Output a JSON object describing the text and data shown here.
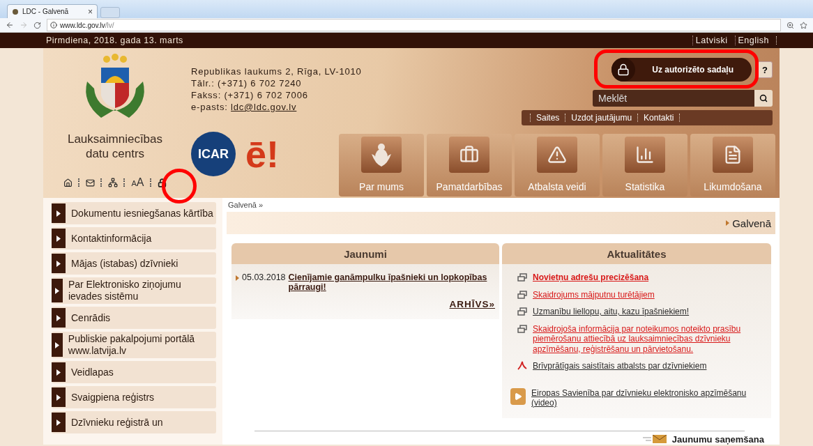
{
  "browser": {
    "tab_title": "LDC - Galvenā",
    "tab_close": "×",
    "url_host": "www.ldc.gov.lv",
    "url_path": "/lv/"
  },
  "top_bar": {
    "date": "Pirmdiena, 2018. gada 13. marts",
    "languages": [
      "Latviski",
      "English"
    ]
  },
  "header": {
    "org_name": [
      "Lauksaimniecības",
      "datu centrs"
    ],
    "address": "Republikas laukums 2, Rīga, LV-1010",
    "phone": "Tālr.: (+371) 6 702 7240",
    "fax": "Fakss: (+371) 6 702 7006",
    "email_label": "e-pasts:",
    "email": "ldc@ldc.gov.lv",
    "icar_logo": "ICAR",
    "e_logo": "ē!",
    "tools": [
      {
        "kind": "home"
      },
      {
        "kind": "mail"
      },
      {
        "kind": "sitemap"
      },
      {
        "kind": "fontsize",
        "small": "A",
        "large": "A"
      },
      {
        "kind": "lock"
      }
    ],
    "auth_button": "Uz autorizēto sadaļu",
    "help_button": "?",
    "search": {
      "placeholder": "Meklēt"
    },
    "links": [
      "Saites",
      "Uzdot jautājumu",
      "Kontakti"
    ],
    "nav": [
      {
        "label": "Par mums",
        "kind": "emblem"
      },
      {
        "label": "Pamatdarbības",
        "kind": "briefcase"
      },
      {
        "label": "Atbalsta veidi",
        "kind": "warning"
      },
      {
        "label": "Statistika",
        "kind": "chart"
      },
      {
        "label": "Likumdošana",
        "kind": "document"
      }
    ]
  },
  "sidebar": {
    "items": [
      "Dokumentu iesniegšanas kārtība",
      "Kontaktinformācija",
      "Mājas (istabas) dzīvnieki",
      "Par Elektronisko ziņojumu ievades sistēmu",
      "Cenrādis",
      "Publiskie pakalpojumi portālā www.latvija.lv",
      "Veidlapas",
      "Svaigpiena reģistrs",
      "Dzīvnieku reģistrā un"
    ]
  },
  "breadcrumb": "Galvenā »",
  "page_title": "Galvenā",
  "news": {
    "title": "Jaunumi",
    "items": [
      {
        "date": "05.03.2018",
        "title": "Cienījamie ganāmpulku īpašnieki un lopkopības pārraugi!"
      }
    ],
    "archive": "ARHĪVS»"
  },
  "current": {
    "title": "Aktualitātes",
    "items": [
      {
        "kind": "window",
        "text": "Novietņu adrešu precizēšana",
        "alert": true,
        "bold": true
      },
      {
        "kind": "window",
        "text": "Skaidrojums mājputnu turētājiem",
        "alert": true,
        "bold": false
      },
      {
        "kind": "window",
        "text": "Uzmanību liellopu, aitu, kazu īpašniekiem!",
        "alert": false,
        "bold": false
      },
      {
        "kind": "window",
        "text": "Skaidrojoša informācija par noteikumos noteikto prasību piemērošanu attiecībā uz lauksaimniecības dzīvnieku apzīmēšanu, reģistrēšanu un pārvietošanu.",
        "alert": true,
        "bold": false
      },
      {
        "kind": "pdf",
        "text": "Brīvprātīgais saistītais atbalsts par dzīvniekiem",
        "alert": false,
        "bold": false
      },
      {
        "kind": "video",
        "text": "Eiropas Savienība par dzīvnieku elektronisko apzīmēšanu (video)",
        "alert": false,
        "bold": false
      }
    ]
  },
  "subscribe": "Jaunumu saņemšana"
}
